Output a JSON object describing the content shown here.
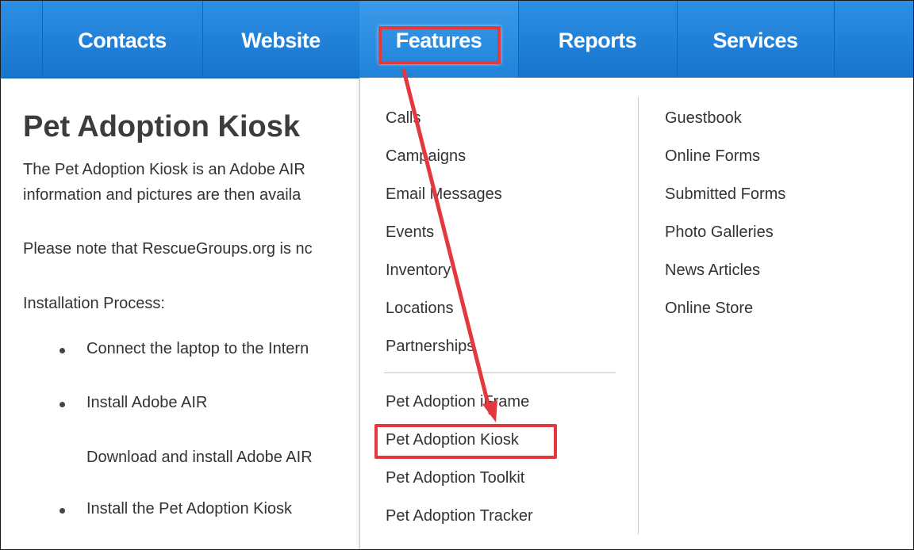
{
  "nav": {
    "items": [
      {
        "label": "Contacts"
      },
      {
        "label": "Website"
      },
      {
        "label": "Features"
      },
      {
        "label": "Reports"
      },
      {
        "label": "Services"
      }
    ]
  },
  "page": {
    "title": "Pet Adoption Kiosk",
    "intro_line1": "The Pet Adoption Kiosk is an Adobe AIR",
    "intro_line2": "information and pictures are then availa",
    "note": "Please note that RescueGroups.org is nc",
    "install_heading": "Installation Process:",
    "steps": [
      "Connect the laptop to the Intern",
      "Install Adobe AIR",
      "Install the Pet Adoption Kiosk"
    ],
    "sub_step": "Download and install Adobe AIR"
  },
  "dropdown": {
    "left_group_1": [
      "Calls",
      "Campaigns",
      "Email Messages",
      "Events",
      "Inventory",
      "Locations",
      "Partnerships"
    ],
    "left_group_2": [
      "Pet Adoption iFrame",
      "Pet Adoption Kiosk",
      "Pet Adoption Toolkit",
      "Pet Adoption Tracker"
    ],
    "right": [
      "Guestbook",
      "Online Forms",
      "Submitted Forms",
      "Photo Galleries",
      "News Articles",
      "Online Store"
    ]
  },
  "colors": {
    "nav_blue": "#1e82d6",
    "annotation_red": "#e2383e",
    "text": "#333333"
  }
}
